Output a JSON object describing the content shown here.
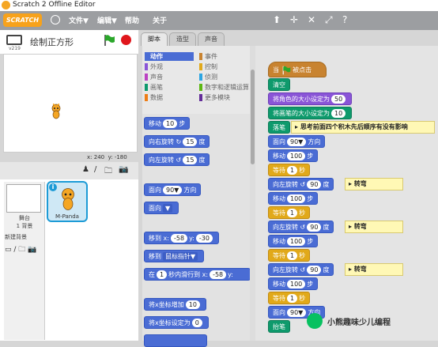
{
  "window": {
    "title": "Scratch 2 Offline Editor"
  },
  "menubar": {
    "logo": "SCRATCH",
    "file": "文件▼",
    "edit": "编辑▼",
    "help": "帮助",
    "about": "关于",
    "tools": [
      "⬆",
      "✛",
      "✕",
      "⤢",
      "?"
    ]
  },
  "stage_header": {
    "version": "v219",
    "project_name": "绘制正方形"
  },
  "stage": {
    "coords": {
      "x_label": "x:",
      "x_value": "240",
      "y_label": "y:",
      "y_value": "-180"
    }
  },
  "sprite_pane": {
    "new_sprite_icons": [
      "♟",
      "/",
      "🗀",
      "📷"
    ],
    "stage_label": "舞台",
    "stage_backdrops": "1 背景",
    "new_backdrop_label": "新建背景",
    "new_backdrop_icons": [
      "▭",
      "/",
      "🗀",
      "📷"
    ],
    "sprite_info": "i",
    "sprite_name": "M-Panda"
  },
  "tabs": [
    "脚本",
    "造型",
    "声音"
  ],
  "categories": [
    {
      "label": "动作",
      "color": "#4a6cd4"
    },
    {
      "label": "外观",
      "color": "#8a55d7"
    },
    {
      "label": "声音",
      "color": "#bb42c3"
    },
    {
      "label": "画笔",
      "color": "#0e9a6c"
    },
    {
      "label": "数据",
      "color": "#ee7d16"
    },
    {
      "label": "事件",
      "color": "#c88330"
    },
    {
      "label": "控制",
      "color": "#e1a91a"
    },
    {
      "label": "侦测",
      "color": "#2ca5e2"
    },
    {
      "label": "数字和逻辑运算",
      "color": "#5cb712"
    },
    {
      "label": "更多模块",
      "color": "#632d99"
    }
  ],
  "palette_blocks": {
    "move": {
      "pre": "移动",
      "val": "10",
      "post": "步"
    },
    "turn_right": {
      "pre": "向右旋转",
      "icon": "↻",
      "val": "15",
      "post": "度"
    },
    "turn_left": {
      "pre": "向左旋转",
      "icon": "↺",
      "val": "15",
      "post": "度"
    },
    "point_dir": {
      "pre": "面向",
      "val": "90▼",
      "post": "方向"
    },
    "point_towards": {
      "pre": "面向",
      "val": "▼"
    },
    "goto_xy": {
      "pre": "移到 x:",
      "x": "-58",
      "ymid": "y:",
      "y": "-30"
    },
    "goto_target": {
      "pre": "移到",
      "val": "鼠标指针▼"
    },
    "glide": {
      "pre": "在",
      "secs": "1",
      "mid": "秒内滑行到 x:",
      "x": "-58",
      "ymid": "y:"
    },
    "change_x": {
      "pre": "将x坐标增加",
      "val": "10"
    },
    "set_x": {
      "pre": "将x坐标设定为",
      "val": "0"
    }
  },
  "script": {
    "hat": {
      "pre": "当",
      "post": "被点击"
    },
    "clear": "清空",
    "set_size": {
      "pre": "将角色的大小设定为",
      "val": "50"
    },
    "set_pen_size": {
      "pre": "将画笔的大小设定为",
      "val": "10"
    },
    "pen_down": "落笔",
    "comment": "思考前面四个积木先后顺序有没有影响",
    "point": {
      "pre": "面向",
      "val": "90▼",
      "post": "方向"
    },
    "move": {
      "pre": "移动",
      "val": "100",
      "post": "步"
    },
    "wait": {
      "pre": "等待",
      "val": "1",
      "post": "秒"
    },
    "turn": {
      "pre": "向左旋转",
      "icon": "↺",
      "val": "90",
      "post": "度"
    },
    "turn_comment": "转弯",
    "pen_up": "抬笔"
  },
  "watermark": "小熊趣味少儿编程"
}
